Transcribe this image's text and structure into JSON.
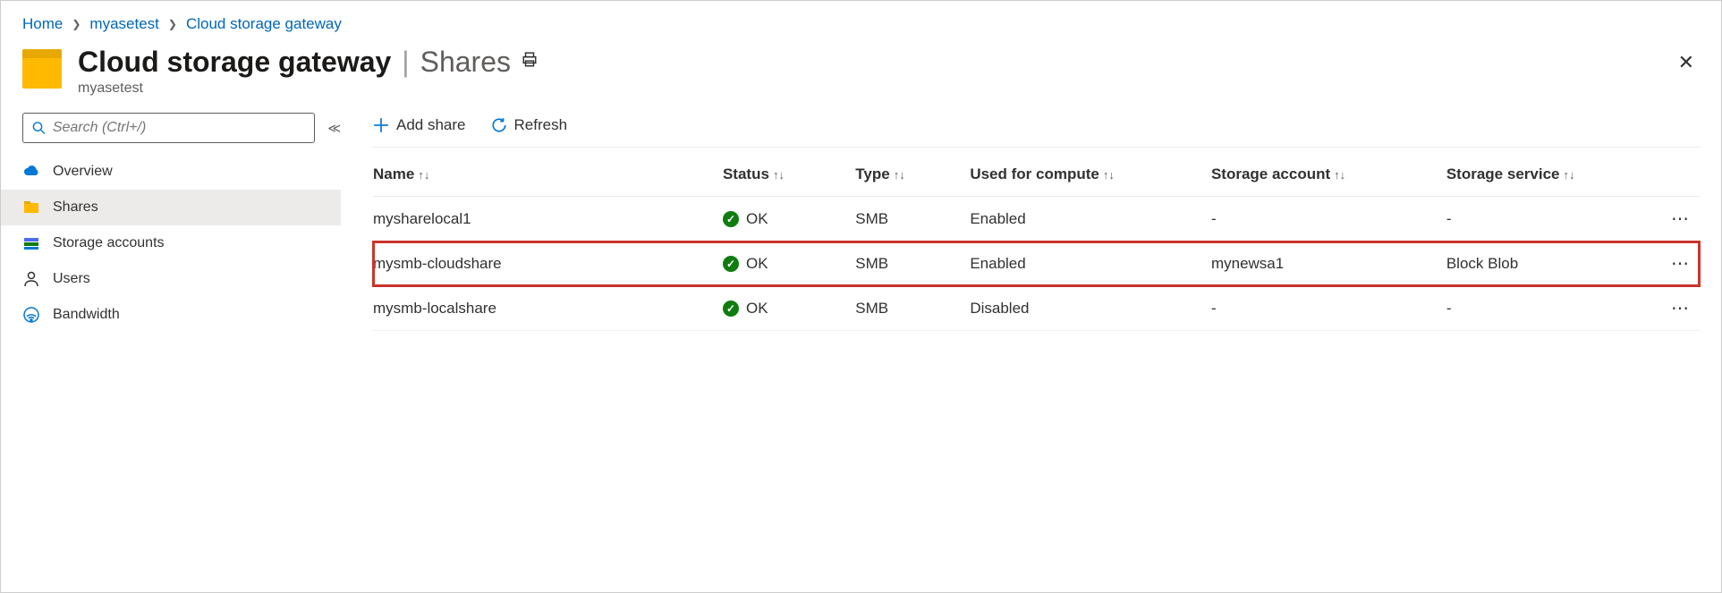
{
  "breadcrumb": {
    "items": [
      {
        "label": "Home"
      },
      {
        "label": "myasetest"
      },
      {
        "label": "Cloud storage gateway"
      }
    ]
  },
  "header": {
    "title": "Cloud storage gateway",
    "section": "Shares",
    "resource": "myasetest"
  },
  "search": {
    "placeholder": "Search (Ctrl+/)"
  },
  "sidebar": {
    "items": [
      {
        "label": "Overview",
        "icon": "cloud"
      },
      {
        "label": "Shares",
        "icon": "folder",
        "active": true
      },
      {
        "label": "Storage accounts",
        "icon": "storage"
      },
      {
        "label": "Users",
        "icon": "user"
      },
      {
        "label": "Bandwidth",
        "icon": "wifi"
      }
    ]
  },
  "toolbar": {
    "add_label": "Add share",
    "refresh_label": "Refresh"
  },
  "table": {
    "columns": {
      "name": "Name",
      "status": "Status",
      "type": "Type",
      "compute": "Used for compute",
      "account": "Storage account",
      "service": "Storage service"
    },
    "rows": [
      {
        "name": "mysharelocal1",
        "status": "OK",
        "type": "SMB",
        "compute": "Enabled",
        "account": "-",
        "service": "-",
        "highlight": false
      },
      {
        "name": "mysmb-cloudshare",
        "status": "OK",
        "type": "SMB",
        "compute": "Enabled",
        "account": "mynewsa1",
        "service": "Block Blob",
        "highlight": true
      },
      {
        "name": "mysmb-localshare",
        "status": "OK",
        "type": "SMB",
        "compute": "Disabled",
        "account": "-",
        "service": "-",
        "highlight": false
      }
    ]
  }
}
